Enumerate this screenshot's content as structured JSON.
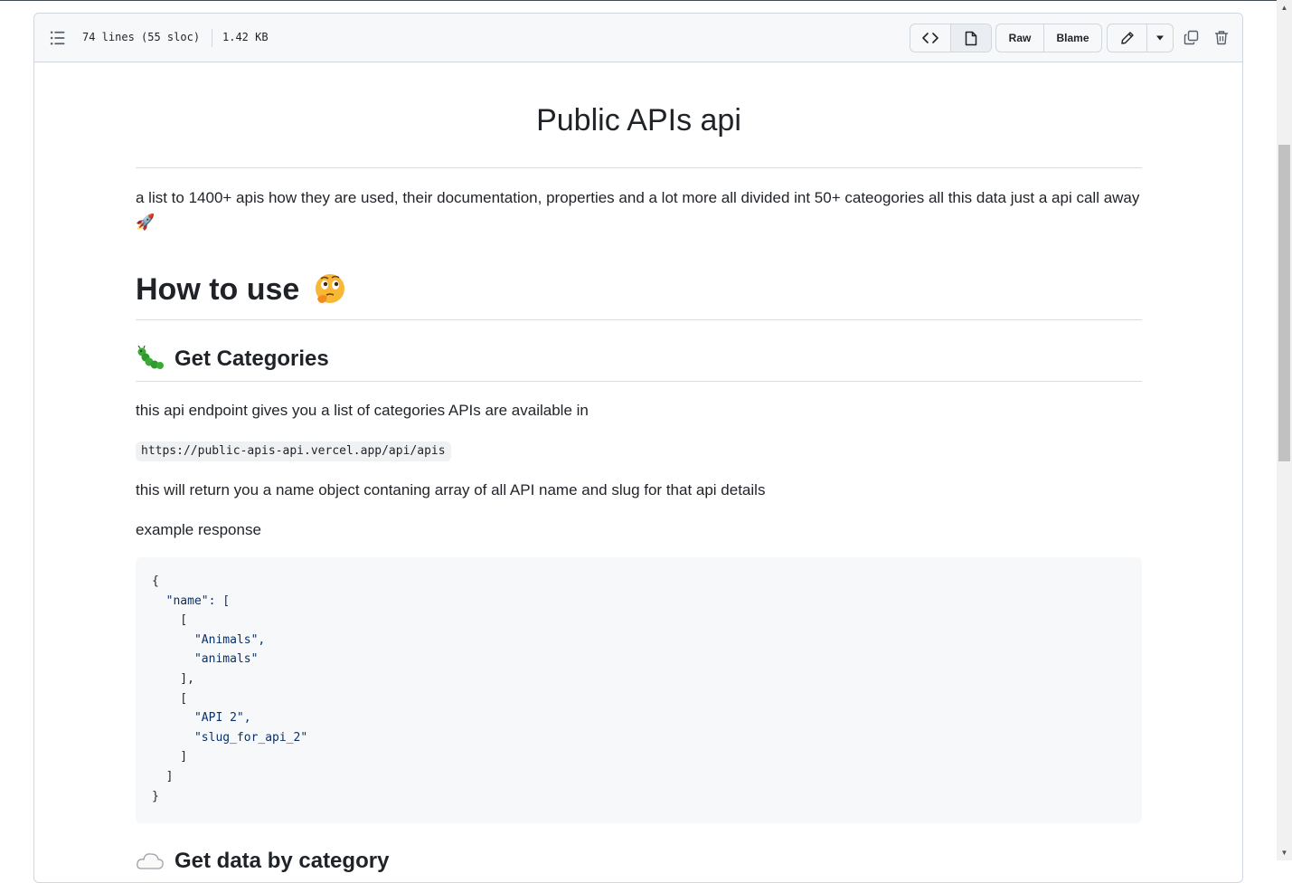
{
  "file_header": {
    "lines_info": "74 lines (55 sloc)",
    "size_info": "1.42 KB",
    "raw_label": "Raw",
    "blame_label": "Blame"
  },
  "readme": {
    "title": "Public APIs api",
    "intro": "a list to 1400+ apis how they are used, their documentation, properties and a lot more all divided int 50+ cateogories all this data just a api call away 🚀",
    "how_to_use": "How to use",
    "section1_heading": "Get Categories",
    "section1_desc": "this api endpoint gives you a list of categories APIs are available in",
    "endpoint": "https://public-apis-api.vercel.app/api/apis",
    "return_desc": "this will return you a name object contaning array of all API name and slug for that api details",
    "example_label": "example response",
    "code_lines": [
      "{",
      "  \"name\": [",
      "    [",
      "      \"Animals\",",
      "      \"animals\"",
      "    ],",
      "    [",
      "      \"API 2\",",
      "      \"slug_for_api_2\"",
      "    ]",
      "  ]",
      "}"
    ],
    "section2_heading": "Get data by category"
  },
  "colors": {
    "accent_border": "#d0d7de",
    "header_bg": "#f6f8fa",
    "text": "#1f2328"
  },
  "icons": [
    "list-unordered-icon",
    "code-icon",
    "file-icon",
    "pencil-icon",
    "triangle-down-icon",
    "copy-icon",
    "trash-icon",
    "thinking-face-emoji",
    "caterpillar-emoji",
    "cloud-emoji"
  ]
}
